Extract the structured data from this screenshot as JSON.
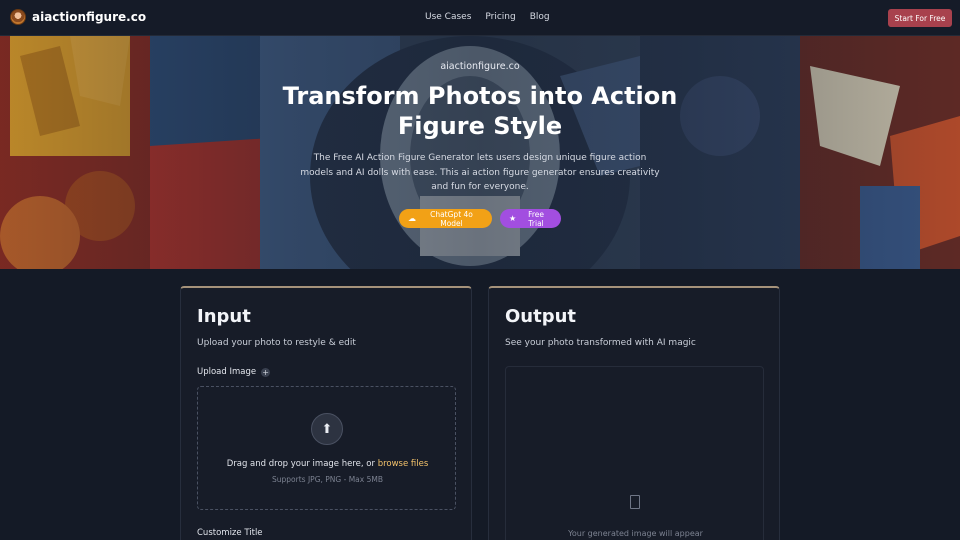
{
  "header": {
    "brand": "aiactionfigure.co",
    "nav": [
      "Use Cases",
      "Pricing",
      "Blog"
    ],
    "cta_label": "Start For Free"
  },
  "hero": {
    "eyebrow": "aiactionfigure.co",
    "title": "Transform Photos into Action Figure Style",
    "description": "The Free AI Action Figure Generator lets users design unique figure action models and AI dolls with ease. This ai action figure generator ensures creativity and fun for everyone.",
    "badges": [
      {
        "label": "ChatGpt 4o Model",
        "icon": "openai-icon",
        "color": "#f2a116"
      },
      {
        "label": "Free Trial",
        "icon": "star-icon",
        "color": "#a24ee0"
      }
    ]
  },
  "input_panel": {
    "title": "Input",
    "subtitle": "Upload your photo to restyle & edit",
    "upload_label": "Upload Image",
    "drop_text": "Drag and drop your image here, or",
    "browse_text": "browse files",
    "drop_hint": "Supports JPG, PNG - Max 5MB",
    "customize_label": "Customize Title"
  },
  "output_panel": {
    "title": "Output",
    "subtitle": "See your photo transformed with AI magic",
    "placeholder": "Your generated image will appear"
  },
  "colors": {
    "background": "#141a26",
    "cta": "#a8414d",
    "accent_link": "#f3c26b",
    "panel_border_top": "#a5927a"
  }
}
